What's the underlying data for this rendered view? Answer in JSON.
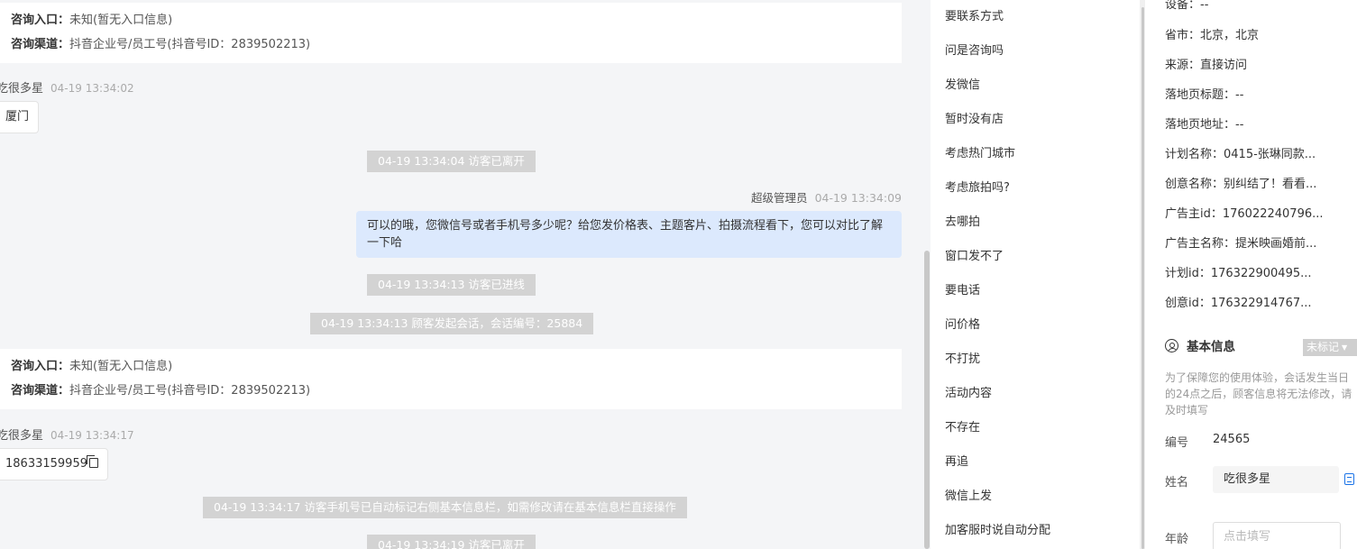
{
  "chat": {
    "card1": {
      "entry_label": "咨询入口：",
      "entry_value": "未知(暂无入口信息)",
      "channel_label": "咨询渠道：",
      "channel_value": "抖音企业号/员工号(抖音号ID：2839502213)"
    },
    "msg1": {
      "visitor": "吃很多星",
      "time": "04-19 13:34:02",
      "text": "厦门"
    },
    "sys1": "04-19 13:34:04 访客已离开",
    "agent": {
      "name": "超级管理员",
      "time": "04-19 13:34:09",
      "text": "可以的哦，您微信号或者手机号多少呢？给您发价格表、主题客片、拍摄流程看下，您可以对比了解一下哈"
    },
    "sys2": "04-19 13:34:13 访客已进线",
    "sys3": "04-19 13:34:13 顾客发起会话，会话编号：25884",
    "card2": {
      "entry_label": "咨询入口：",
      "entry_value": "未知(暂无入口信息)",
      "channel_label": "咨询渠道：",
      "channel_value": "抖音企业号/员工号(抖音号ID：2839502213)"
    },
    "msg2": {
      "visitor": "吃很多星",
      "time": "04-19 13:34:17",
      "text": "18633159959"
    },
    "sys4": "04-19 13:34:17 访客手机号已自动标记右侧基本信息栏，如需修改请在基本信息栏直接操作",
    "sys5": "04-19 13:34:19 访客已离开"
  },
  "quick_replies": [
    "要联系方式",
    "问是咨询吗",
    "发微信",
    "暂时没有店",
    "考虑热门城市",
    "考虑旅拍吗?",
    "去哪拍",
    "窗口发不了",
    "要电话",
    "问价格",
    "不打扰",
    "活动内容",
    "不存在",
    "再追",
    "微信上发",
    "加客服时说自动分配"
  ],
  "side": {
    "device": "设备：--",
    "province": "省市：北京，北京",
    "source": "来源：直接访问",
    "landing_title": "落地页标题：--",
    "landing_url": "落地页地址：--",
    "plan_name": "计划名称：0415-张琳同款...",
    "creative_name": "创意名称：别纠结了！看看...",
    "advertiser_id": "广告主id：176022240796...",
    "advertiser_name": "广告主名称：提米映画婚前...",
    "plan_id": "计划id：176322900495...",
    "creative_id": "创意id：176322914767...",
    "basic_title": "基本信息",
    "tag": "未标记",
    "note": "为了保障您的使用体验，会话发生当日的24点之后，顾客信息将无法修改，请及时填写",
    "no_label": "编号",
    "no_value": "24565",
    "name_label": "姓名",
    "name_value": "吃很多星",
    "age_label": "年龄",
    "age_placeholder": "点击填写"
  }
}
